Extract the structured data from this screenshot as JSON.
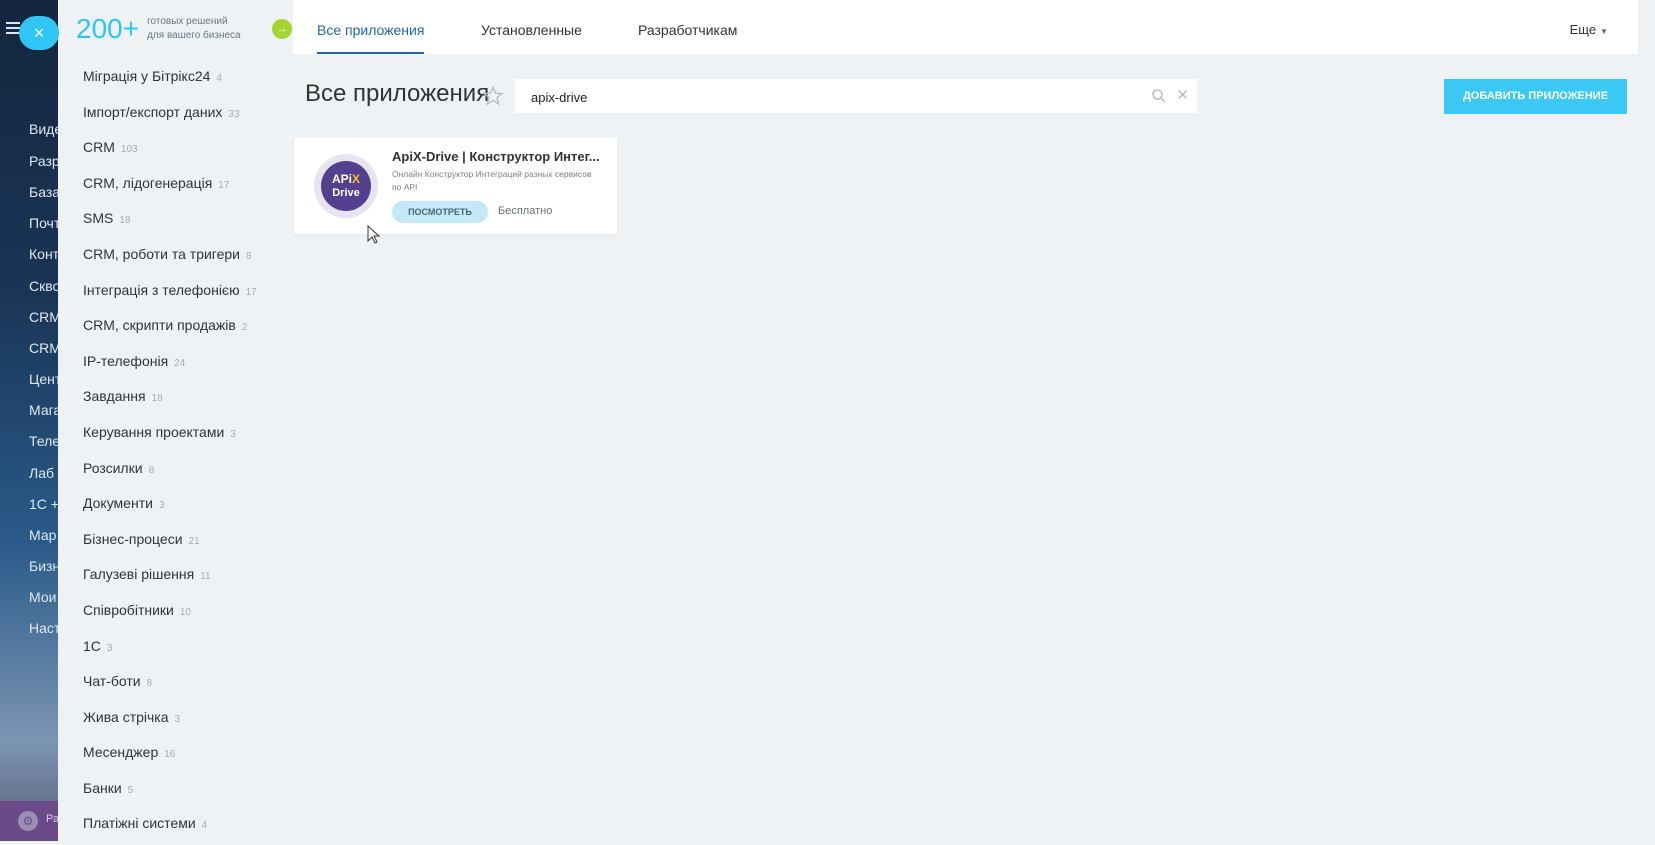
{
  "background_portal": {
    "items": [
      "Виде",
      "Разр",
      "База",
      "Почт",
      "Конт",
      "Скво",
      "CRM",
      "CRM",
      "Цент",
      "Мага",
      "Теле",
      "Лаб",
      "1С +",
      "Мар",
      "Бизн",
      "Мои",
      "Наст"
    ]
  },
  "promo": {
    "count": "200+",
    "line1": "готовых решений",
    "line2": "для вашего бизнеса"
  },
  "categories": [
    {
      "label": "Міграція у Бітрікс24",
      "count": "4"
    },
    {
      "label": "Імпорт/експорт даних",
      "count": "33"
    },
    {
      "label": "CRM",
      "count": "103"
    },
    {
      "label": "CRM, лідогенерація",
      "count": "17"
    },
    {
      "label": "SMS",
      "count": "18"
    },
    {
      "label": "CRM, роботи та тригери",
      "count": "8"
    },
    {
      "label": "Інтеграція з телефонією",
      "count": "17"
    },
    {
      "label": "CRM, скрипти продажів",
      "count": "2"
    },
    {
      "label": "IP-телефонія",
      "count": "24"
    },
    {
      "label": "Завдання",
      "count": "18"
    },
    {
      "label": "Керування проектами",
      "count": "3"
    },
    {
      "label": "Розсилки",
      "count": "8"
    },
    {
      "label": "Документи",
      "count": "3"
    },
    {
      "label": "Бізнес-процеси",
      "count": "21"
    },
    {
      "label": "Галузеві рішення",
      "count": "11"
    },
    {
      "label": "Співробітники",
      "count": "10"
    },
    {
      "label": "1С",
      "count": "3"
    },
    {
      "label": "Чат-боти",
      "count": "8"
    },
    {
      "label": "Жива стрічка",
      "count": "3"
    },
    {
      "label": "Месенджер",
      "count": "16"
    },
    {
      "label": "Банки",
      "count": "5"
    },
    {
      "label": "Платіжні системи",
      "count": "4"
    }
  ],
  "tabs": {
    "all": "Все приложения",
    "installed": "Установленные",
    "developers": "Разработчикам",
    "more": "Еще"
  },
  "header": {
    "title": "Все приложения",
    "search_value": "apix-drive",
    "add_button": "ДОБАВИТЬ ПРИЛОЖЕНИЕ"
  },
  "app_card": {
    "logo_line1_a": "APi",
    "logo_line1_b": "X",
    "logo_line2": "Drive",
    "title": "ApiX-Drive | Конструктор Интег...",
    "description": "Онлайн Конструктор Интеграций разных сервисов по API",
    "view_button": "ПОСМОТРЕТЬ",
    "price": "Бесплатно"
  },
  "colors": {
    "accent": "#2fc6f6",
    "tab_active": "#2067b0",
    "promo_go": "#a5d533",
    "logo_bg": "#54408e"
  }
}
